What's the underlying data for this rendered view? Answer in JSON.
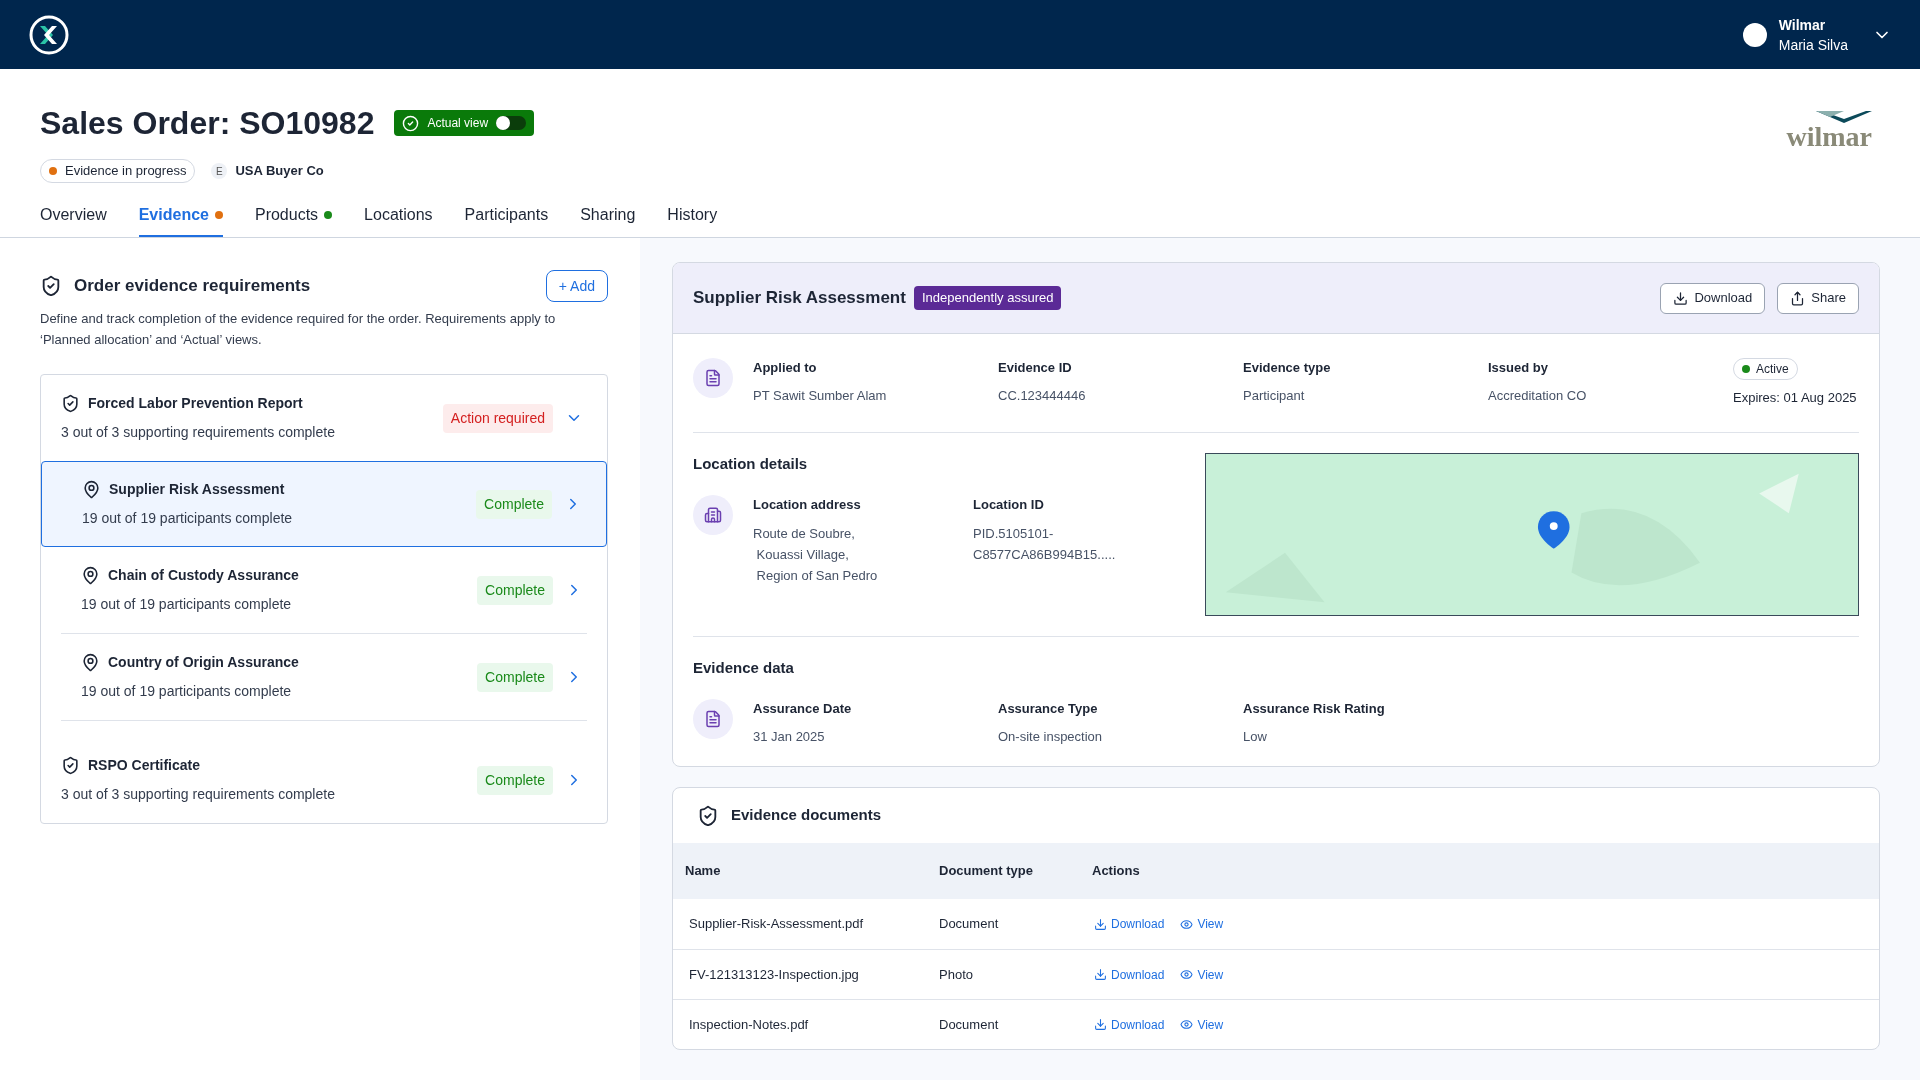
{
  "user": {
    "org": "Wilmar",
    "name": "Maria Silva"
  },
  "order": {
    "title": "Sales Order: SO10982",
    "view_toggle": {
      "label": "Actual view",
      "on": false
    },
    "status": {
      "label": "Evidence in progress",
      "color": "#e07010"
    },
    "buyer": {
      "initial": "E",
      "name": "USA Buyer Co"
    },
    "logo_text": "wilmar"
  },
  "tabs": [
    {
      "label": "Overview",
      "selected": false
    },
    {
      "label": "Evidence",
      "selected": true,
      "color": "#e07010"
    },
    {
      "label": "Products",
      "selected": false,
      "color": "#1a8a1a"
    },
    {
      "label": "Locations",
      "selected": false
    },
    {
      "label": "Participants",
      "selected": false
    },
    {
      "label": "Sharing",
      "selected": false
    },
    {
      "label": "History",
      "selected": false
    }
  ],
  "requirements": {
    "title": "Order evidence requirements",
    "add_button": "+ Add",
    "description": "Define and track completion of the evidence required for the order. Requirements apply to ‘Planned allocation’ and ‘Actual’ views.",
    "items": [
      {
        "kind": "group",
        "title": "Forced Labor Prevention Report",
        "subtitle": "3 out of 3 supporting requirements complete",
        "status": {
          "label": "Action required",
          "kind": "action"
        },
        "expanded": true,
        "selected": false,
        "children": [
          {
            "kind": "item",
            "title": "Supplier Risk Assessment",
            "subtitle": "19 out of 19 participants complete",
            "status": {
              "label": "Complete",
              "kind": "complete"
            },
            "selected": true
          },
          {
            "kind": "item",
            "title": "Chain of Custody Assurance",
            "subtitle": "19 out of 19 participants complete",
            "status": {
              "label": "Complete",
              "kind": "complete"
            },
            "selected": false
          },
          {
            "kind": "item",
            "title": "Country of Origin Assurance",
            "subtitle": "19 out of 19 participants complete",
            "status": {
              "label": "Complete",
              "kind": "complete"
            },
            "selected": false
          }
        ]
      },
      {
        "kind": "group",
        "title": "RSPO Certificate",
        "subtitle": "3 out of 3 supporting requirements complete",
        "status": {
          "label": "Complete",
          "kind": "complete"
        },
        "expanded": false,
        "selected": false
      }
    ]
  },
  "detail": {
    "title": "Supplier Risk Assessment",
    "badge": "Independently assured",
    "buttons": [
      {
        "label": "Download",
        "kind": "download"
      },
      {
        "label": "Share",
        "kind": "share"
      }
    ],
    "fields": [
      {
        "label": "Applied to",
        "value": "PT Sawit Sumber Alam"
      },
      {
        "label": "Evidence ID",
        "value": "CC.123444446"
      },
      {
        "label": "Evidence type",
        "value": "Participant"
      },
      {
        "label": "Issued by",
        "value": "Accreditation CO"
      }
    ],
    "state": {
      "label": "Active",
      "color": "#1a8a1a",
      "expires": "Expires: 01 Aug 2025"
    },
    "location": {
      "title": "Location details",
      "fields": [
        {
          "label": "Location address",
          "lines": [
            "Route de Soubre,",
            " Kouassi Village,",
            " Region of San Pedro"
          ]
        },
        {
          "label": "Location ID",
          "lines": [
            "PID.5105101-",
            "C8577CA86B994B15....."
          ]
        }
      ]
    },
    "evidence_data": {
      "title": "Evidence data",
      "fields": [
        {
          "label": "Assurance Date",
          "value": "31 Jan 2025"
        },
        {
          "label": "Assurance Type",
          "value": "On-site inspection"
        },
        {
          "label": "Assurance Risk Rating",
          "value": "Low"
        }
      ]
    }
  },
  "documents": {
    "title": "Evidence documents",
    "columns": [
      "Name",
      "Document type",
      "Actions"
    ],
    "rows": [
      {
        "name": "Supplier-Risk-Assessment.pdf",
        "type": "Document",
        "actions": [
          "Download",
          "View"
        ]
      },
      {
        "name": "FV-121313123-Inspection.jpg",
        "type": "Photo",
        "actions": [
          "Download",
          "View"
        ]
      },
      {
        "name": "Inspection-Notes.pdf",
        "type": "Document",
        "actions": [
          "Download",
          "View"
        ]
      }
    ]
  }
}
